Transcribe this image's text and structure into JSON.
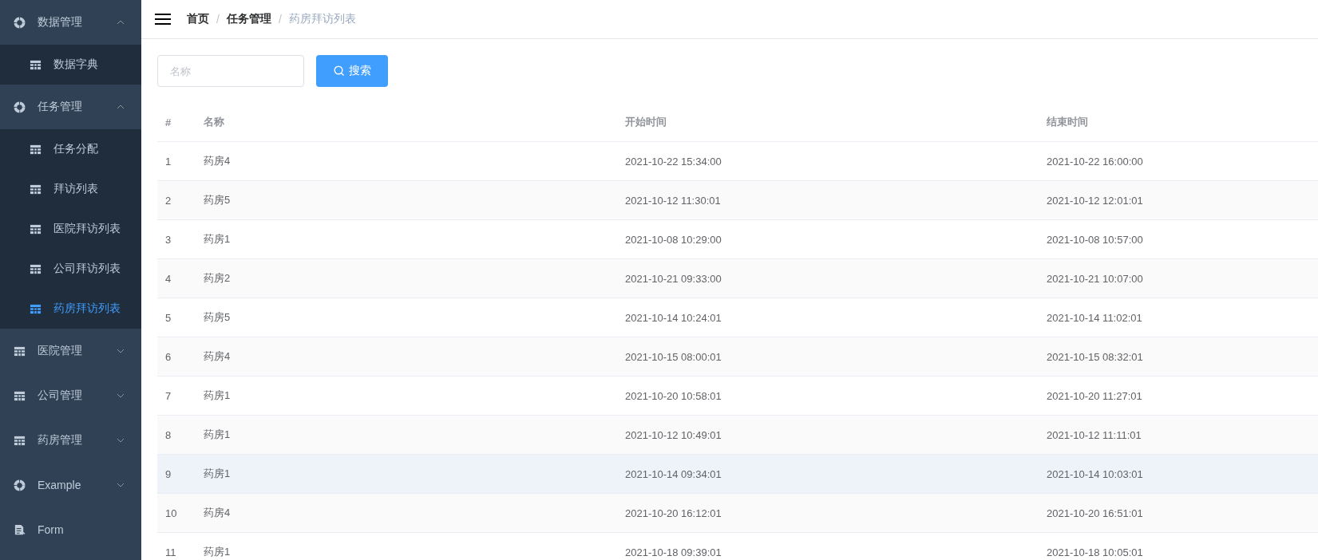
{
  "sidebar": {
    "items": [
      {
        "label": "数据管理",
        "kind": "ring",
        "expanded": true,
        "children": [
          {
            "label": "数据字典",
            "selected": false
          }
        ]
      },
      {
        "label": "任务管理",
        "kind": "ring",
        "expanded": true,
        "children": [
          {
            "label": "任务分配",
            "selected": false
          },
          {
            "label": "拜访列表",
            "selected": false
          },
          {
            "label": "医院拜访列表",
            "selected": false
          },
          {
            "label": "公司拜访列表",
            "selected": false
          },
          {
            "label": "药房拜访列表",
            "selected": true
          }
        ]
      },
      {
        "label": "医院管理",
        "kind": "grid",
        "expanded": false
      },
      {
        "label": "公司管理",
        "kind": "grid",
        "expanded": false
      },
      {
        "label": "药房管理",
        "kind": "grid",
        "expanded": false
      },
      {
        "label": "Example",
        "kind": "ring",
        "expanded": false
      },
      {
        "label": "Form",
        "kind": "doc"
      }
    ]
  },
  "breadcrumb": {
    "separator": "/",
    "items": [
      "首页",
      "任务管理",
      "药房拜访列表"
    ]
  },
  "search": {
    "placeholder": "名称",
    "button": "搜索"
  },
  "table": {
    "columns": [
      "#",
      "名称",
      "开始时间",
      "结束时间"
    ],
    "rows": [
      {
        "cells": [
          "1",
          "药房4",
          "2021-10-22 15:34:00",
          "2021-10-22 16:00:00"
        ],
        "hovered": false
      },
      {
        "cells": [
          "2",
          "药房5",
          "2021-10-12 11:30:01",
          "2021-10-12 12:01:01"
        ],
        "hovered": false
      },
      {
        "cells": [
          "3",
          "药房1",
          "2021-10-08 10:29:00",
          "2021-10-08 10:57:00"
        ],
        "hovered": false
      },
      {
        "cells": [
          "4",
          "药房2",
          "2021-10-21 09:33:00",
          "2021-10-21 10:07:00"
        ],
        "hovered": false
      },
      {
        "cells": [
          "5",
          "药房5",
          "2021-10-14 10:24:01",
          "2021-10-14 11:02:01"
        ],
        "hovered": false
      },
      {
        "cells": [
          "6",
          "药房4",
          "2021-10-15 08:00:01",
          "2021-10-15 08:32:01"
        ],
        "hovered": false
      },
      {
        "cells": [
          "7",
          "药房1",
          "2021-10-20 10:58:01",
          "2021-10-20 11:27:01"
        ],
        "hovered": false
      },
      {
        "cells": [
          "8",
          "药房1",
          "2021-10-12 10:49:01",
          "2021-10-12 11:11:01"
        ],
        "hovered": false
      },
      {
        "cells": [
          "9",
          "药房1",
          "2021-10-14 09:34:01",
          "2021-10-14 10:03:01"
        ],
        "hovered": true
      },
      {
        "cells": [
          "10",
          "药房4",
          "2021-10-20 16:12:01",
          "2021-10-20 16:51:01"
        ],
        "hovered": false
      },
      {
        "cells": [
          "11",
          "药房1",
          "2021-10-18 09:39:01",
          "2021-10-18 10:05:01"
        ],
        "hovered": false
      }
    ]
  }
}
